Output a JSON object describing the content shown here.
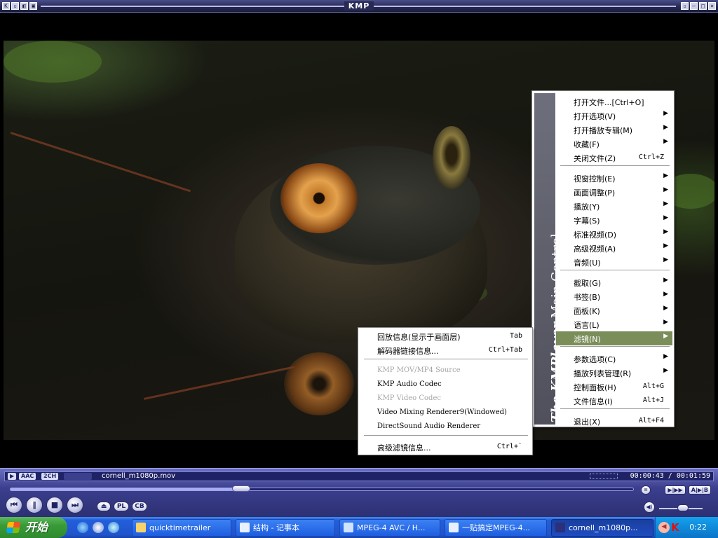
{
  "window": {
    "title": "KMP"
  },
  "video": {
    "side_brand": "The KMPlayer",
    "side_title": "Main Control"
  },
  "main_menu": {
    "items": [
      {
        "label": "打开文件...[Ctrl+O]",
        "shortcut": "",
        "submenu": false
      },
      {
        "label": "打开选项(V)",
        "shortcut": "",
        "submenu": true
      },
      {
        "label": "打开播放专辑(M)",
        "shortcut": "",
        "submenu": true
      },
      {
        "label": "收藏(F)",
        "shortcut": "",
        "submenu": true
      },
      {
        "label": "关闭文件(Z)",
        "shortcut": "Ctrl+Z",
        "submenu": false
      },
      {
        "label": "视窗控制(E)",
        "shortcut": "",
        "submenu": true
      },
      {
        "label": "画面调整(P)",
        "shortcut": "",
        "submenu": true
      },
      {
        "label": "播放(Y)",
        "shortcut": "",
        "submenu": true
      },
      {
        "label": "字幕(S)",
        "shortcut": "",
        "submenu": true
      },
      {
        "label": "标准视频(D)",
        "shortcut": "",
        "submenu": true
      },
      {
        "label": "高级视频(A)",
        "shortcut": "",
        "submenu": true
      },
      {
        "label": "音频(U)",
        "shortcut": "",
        "submenu": true
      },
      {
        "label": "截取(G)",
        "shortcut": "",
        "submenu": true
      },
      {
        "label": "书签(B)",
        "shortcut": "",
        "submenu": true
      },
      {
        "label": "面板(K)",
        "shortcut": "",
        "submenu": true
      },
      {
        "label": "语言(L)",
        "shortcut": "",
        "submenu": true
      },
      {
        "label": "滤镜(N)",
        "shortcut": "",
        "submenu": true,
        "selected": true
      },
      {
        "label": "参数选项(C)",
        "shortcut": "",
        "submenu": true
      },
      {
        "label": "播放列表管理(R)",
        "shortcut": "",
        "submenu": true
      },
      {
        "label": "控制面板(H)",
        "shortcut": "Alt+G",
        "submenu": false
      },
      {
        "label": "文件信息(I)",
        "shortcut": "Alt+J",
        "submenu": false
      },
      {
        "label": "退出(X)",
        "shortcut": "Alt+F4",
        "submenu": false
      }
    ]
  },
  "sub_menu": {
    "items": [
      {
        "label": "回放信息(显示于画面层)",
        "shortcut": "Tab",
        "disabled": false
      },
      {
        "label": "解码器链接信息...",
        "shortcut": "Ctrl+Tab",
        "disabled": false
      },
      {
        "label": "KMP MOV/MP4 Source",
        "shortcut": "",
        "disabled": true
      },
      {
        "label": "KMP Audio Codec",
        "shortcut": "",
        "disabled": false
      },
      {
        "label": "KMP Video Codec",
        "shortcut": "",
        "disabled": true
      },
      {
        "label": "Video Mixing Renderer9(Windowed)",
        "shortcut": "",
        "disabled": false
      },
      {
        "label": "DirectSound Audio Renderer",
        "shortcut": "",
        "disabled": false
      },
      {
        "label": "高级滤镜信息...",
        "shortcut": "Ctrl+`",
        "disabled": false
      }
    ]
  },
  "player": {
    "badge_audio": "AAC",
    "badge_channels": "2CH",
    "badge_extra": "",
    "filename": "cornell_m1080p.mov",
    "time": "00:00:43 / 00:01:59",
    "progress": 0.37,
    "volume": 0.55,
    "btn_pl": "PL",
    "btn_cb": "CB",
    "right_buttons": [
      "▶|▶▶",
      "A|▶|B"
    ]
  },
  "taskbar": {
    "start_label": "开始",
    "tasks": [
      {
        "label": "quicktimetrailer",
        "active": false
      },
      {
        "label": "结构 - 记事本",
        "active": false
      },
      {
        "label": "MPEG-4 AVC / H...",
        "active": false
      },
      {
        "label": "一贴搞定MPEG-4...",
        "active": false
      },
      {
        "label": "cornell_m1080p...",
        "active": true
      }
    ],
    "clock": "0:22"
  }
}
